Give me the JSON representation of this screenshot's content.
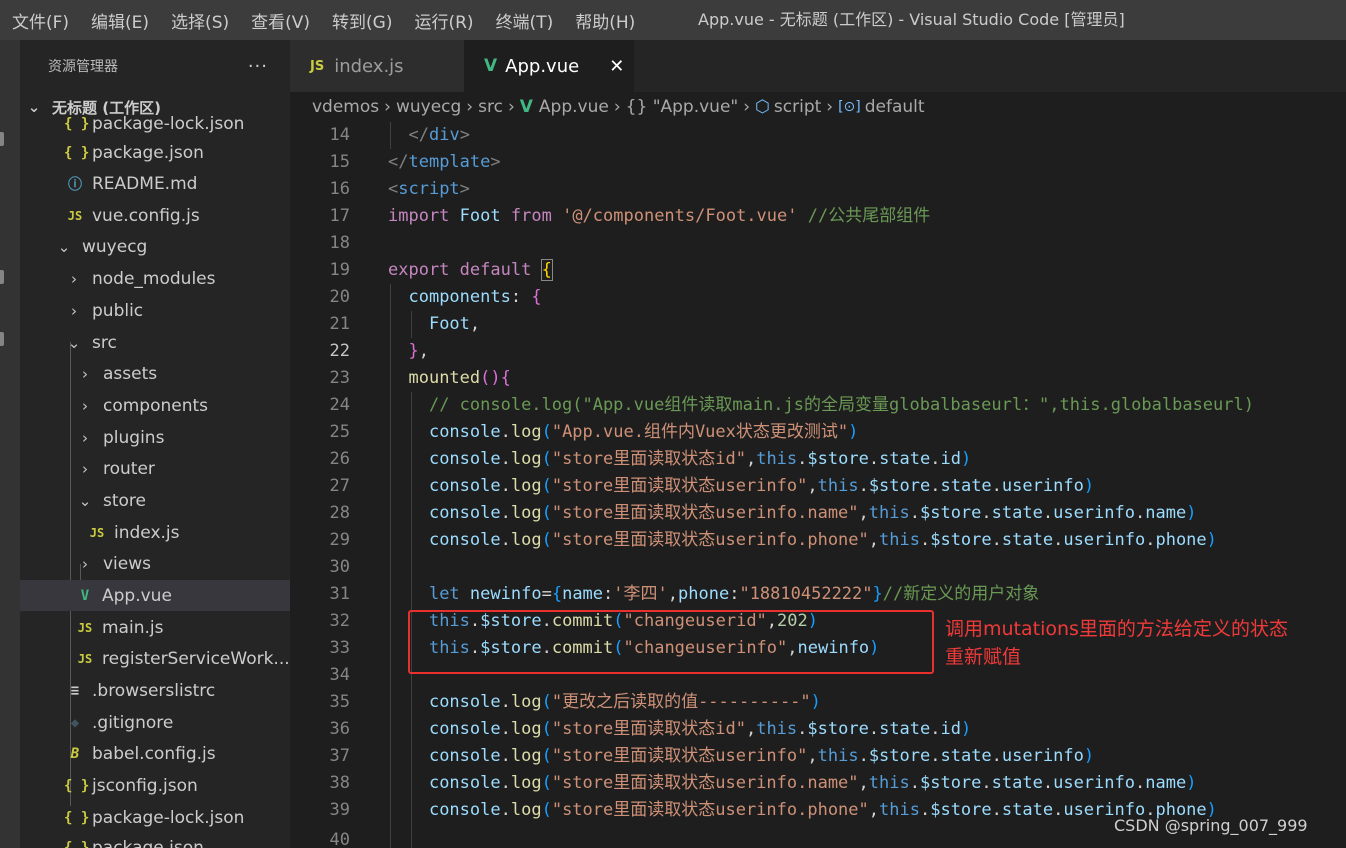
{
  "menu": {
    "items": [
      "文件(F)",
      "编辑(E)",
      "选择(S)",
      "查看(V)",
      "转到(G)",
      "运行(R)",
      "终端(T)",
      "帮助(H)"
    ],
    "window_title": "App.vue - 无标题 (工作区) - Visual Studio Code [管理员]"
  },
  "sidebar": {
    "title": "资源管理器",
    "more": "···",
    "root_label": "无标题 (工作区)",
    "items": [
      {
        "label": "package-lock.json",
        "icon": "{ }"
      },
      {
        "label": "package.json",
        "icon": "{ }"
      },
      {
        "label": "README.md",
        "icon": "ⓘ"
      },
      {
        "label": "vue.config.js",
        "icon": "JS"
      },
      {
        "label": "wuyecg",
        "chevron": "⌄"
      },
      {
        "label": "node_modules",
        "chevron": "›"
      },
      {
        "label": "public",
        "chevron": "›"
      },
      {
        "label": "src",
        "chevron": "⌄"
      },
      {
        "label": "assets",
        "chevron": "›"
      },
      {
        "label": "components",
        "chevron": "›"
      },
      {
        "label": "plugins",
        "chevron": "›"
      },
      {
        "label": "router",
        "chevron": "›"
      },
      {
        "label": "store",
        "chevron": "⌄"
      },
      {
        "label": "index.js",
        "icon": "JS"
      },
      {
        "label": "views",
        "chevron": "›"
      },
      {
        "label": "App.vue",
        "icon": "V"
      },
      {
        "label": "main.js",
        "icon": "JS"
      },
      {
        "label": "registerServiceWork...",
        "icon": "JS"
      },
      {
        "label": ".browserslistrc",
        "icon": "≡"
      },
      {
        "label": ".gitignore",
        "icon": "◆"
      },
      {
        "label": "babel.config.js",
        "icon": "B"
      },
      {
        "label": "jsconfig.json",
        "icon": "{ }"
      },
      {
        "label": "package-lock.json",
        "icon": "{ }"
      },
      {
        "label": "package.json",
        "icon": "{ }"
      }
    ]
  },
  "tabs": [
    {
      "label": "index.js",
      "icon": "JS",
      "active": false
    },
    {
      "label": "App.vue",
      "icon": "V",
      "active": true,
      "close": "✕"
    }
  ],
  "breadcrumb": [
    "vdemos",
    "wuyecg",
    "src",
    "App.vue",
    "{} \"App.vue\"",
    "script",
    "default"
  ],
  "editor": {
    "line_numbers": [
      "14",
      "15",
      "16",
      "17",
      "18",
      "19",
      "20",
      "21",
      "22",
      "23",
      "24",
      "25",
      "26",
      "27",
      "28",
      "29",
      "30",
      "31",
      "32",
      "33",
      "34",
      "35",
      "36",
      "37",
      "38",
      "39",
      "40"
    ],
    "current_line": "22"
  },
  "annotation": {
    "line1": "调用mutations里面的方法给定义的状态",
    "line2": "重新赋值"
  },
  "watermark": "CSDN @spring_007_999",
  "colors": {
    "accent_js": "#cbcb41",
    "accent_vue": "#41b883",
    "annotation_red": "#e8312f",
    "selected_row": "#37373d"
  }
}
